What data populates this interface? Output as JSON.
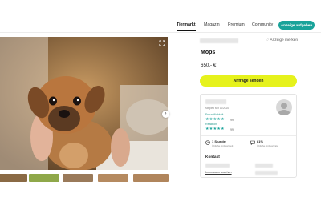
{
  "nav": {
    "tabs": [
      {
        "label": "Tiermarkt",
        "active": true
      },
      {
        "label": "Magazin",
        "active": false
      },
      {
        "label": "Premium",
        "active": false
      },
      {
        "label": "Community",
        "active": false
      }
    ],
    "cta_label": "Anzeige aufgeben"
  },
  "listing": {
    "bookmark_label": "Anzeige merken",
    "bookmark_icon": "heart-outline-icon",
    "title": "Mops",
    "price": "650,- €",
    "request_button": "Anfrage senden"
  },
  "gallery": {
    "expand_icon": "expand-icon",
    "next_icon": "chevron-right-icon",
    "thumbnail_colors": [
      "#8a6a45",
      "#8fa84a",
      "#9a7a5a",
      "#b58a60",
      "#b0855c"
    ]
  },
  "seller": {
    "member_since": "Mitglied seit 11/2016",
    "ratings": [
      {
        "label": "Freundlichkeit",
        "stars": 5,
        "count": "(99)"
      },
      {
        "label": "Reaktion",
        "stars": 5,
        "count": "(99)"
      }
    ],
    "stats": [
      {
        "icon": "clock-icon",
        "value": "1 Stunde",
        "sub": "Übliche Antwortzeit"
      },
      {
        "icon": "chat-icon",
        "value": "81%",
        "sub": "Übliche Antwortrate"
      }
    ],
    "contact_label": "Kontakt",
    "contact_link": "Impressum ansehen"
  },
  "colors": {
    "accent": "#1aa39a",
    "button_yellow": "#e6f21c",
    "star": "#1aa39a"
  }
}
